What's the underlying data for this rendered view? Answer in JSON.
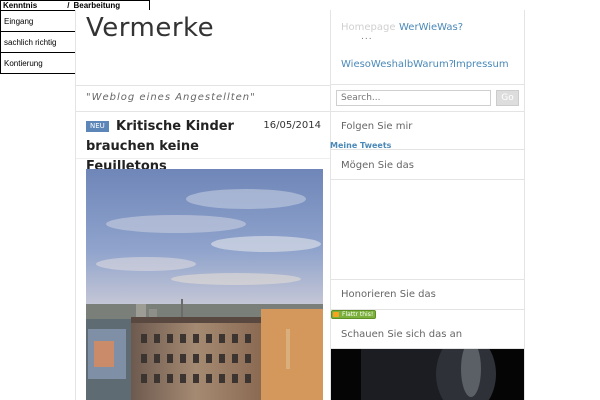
{
  "stamp": {
    "header_left": "Kenntnis",
    "header_sep": "/",
    "header_right": "Bearbeitung",
    "rows": [
      "Eingang",
      "sachlich richtig",
      "Kontierung"
    ]
  },
  "site": {
    "title": "Vermerke",
    "tagline": "\"Weblog eines Angestellten\""
  },
  "post": {
    "badge": "NEU",
    "title": "Kritische Kinder brauchen keine Feuilletons",
    "date": "16/05/2014"
  },
  "nav": {
    "home": "Homepage",
    "dots": "...",
    "wer": "WerWieWas?",
    "wieso": "WiesoWeshalbWarum?",
    "impressum": "Impressum"
  },
  "search": {
    "placeholder": "Search...",
    "button": "Go"
  },
  "sidebar": {
    "follow": "Folgen Sie mir",
    "tweets_link": "Meine Tweets",
    "like": "Mögen Sie das",
    "honor": "Honorieren Sie das",
    "flattr": "Flattr this!",
    "watch": "Schauen Sie sich das an"
  },
  "colors": {
    "link": "#4a89b8",
    "badge": "#5b86b7",
    "flattr": "#7bb03c"
  }
}
